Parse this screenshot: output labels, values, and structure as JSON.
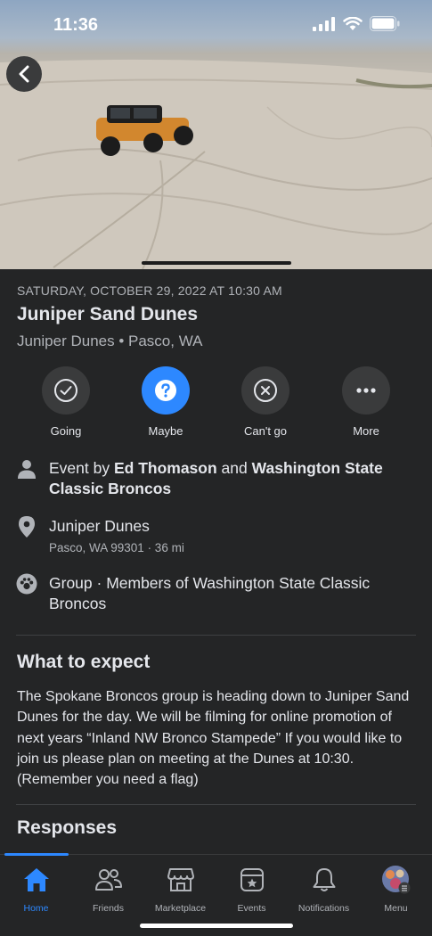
{
  "status_bar": {
    "time": "11:36"
  },
  "event": {
    "date": "SATURDAY, OCTOBER 29, 2022 AT 10:30 AM",
    "title": "Juniper Sand Dunes",
    "location_line": "Juniper Dunes • Pasco, WA"
  },
  "rsvp": [
    {
      "label": "Going",
      "icon": "check-icon",
      "active": false
    },
    {
      "label": "Maybe",
      "icon": "question-icon",
      "active": true
    },
    {
      "label": "Can't go",
      "icon": "x-icon",
      "active": false
    },
    {
      "label": "More",
      "icon": "more-dots-icon",
      "active": false
    }
  ],
  "details": {
    "host_prefix": "Event by ",
    "host_1": "Ed Thomason",
    "host_joiner": " and ",
    "host_2": "Washington State Classic Broncos",
    "place_name": "Juniper Dunes",
    "place_address": "Pasco, WA 99301 · 36 mi",
    "group": "Group · Members of Washington State Classic Broncos"
  },
  "what_to_expect": {
    "heading": "What to expect",
    "body": "The Spokane Broncos group is heading down to Juniper Sand Dunes for the day.  We will be filming for online promotion of next years “Inland NW Bronco Stampede” If you would like to join us please plan on meeting at the Dunes at 10:30.   (Remember you need a flag)"
  },
  "responses": {
    "heading": "Responses"
  },
  "tabs": [
    {
      "label": "Home",
      "icon": "home-icon",
      "active": true
    },
    {
      "label": "Friends",
      "icon": "friends-icon",
      "active": false
    },
    {
      "label": "Marketplace",
      "icon": "marketplace-icon",
      "active": false
    },
    {
      "label": "Events",
      "icon": "events-icon",
      "active": false
    },
    {
      "label": "Notifications",
      "icon": "bell-icon",
      "active": false
    },
    {
      "label": "Menu",
      "icon": "avatar",
      "active": false
    }
  ],
  "colors": {
    "accent": "#2d88ff",
    "background": "#242526",
    "surface": "#3a3b3c"
  }
}
